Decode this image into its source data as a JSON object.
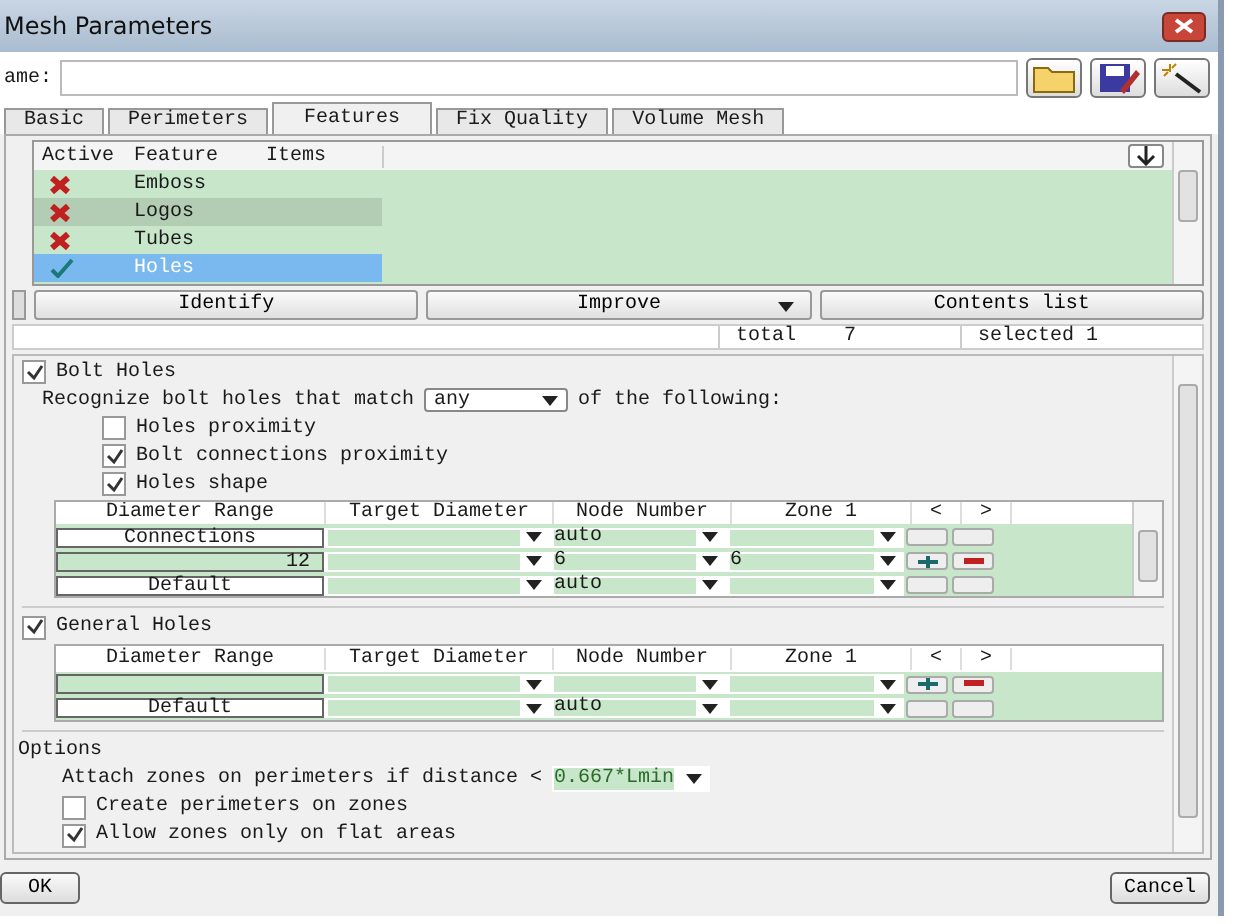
{
  "window": {
    "title": "Mesh Parameters"
  },
  "name_field": {
    "label": "ame:"
  },
  "tabs": [
    {
      "label": "Basic",
      "selected": false
    },
    {
      "label": "Perimeters",
      "selected": false
    },
    {
      "label": "Features",
      "selected": true
    },
    {
      "label": "Fix Quality",
      "selected": false
    },
    {
      "label": "Volume Mesh",
      "selected": false
    }
  ],
  "features": {
    "columns": [
      "Active",
      "Feature",
      "Items"
    ],
    "rows": [
      {
        "name": "Emboss",
        "active": false,
        "selected": false,
        "hovered": false
      },
      {
        "name": "Logos",
        "active": false,
        "selected": false,
        "hovered": true
      },
      {
        "name": "Tubes",
        "active": false,
        "selected": false,
        "hovered": false
      },
      {
        "name": "Holes",
        "active": true,
        "selected": true,
        "hovered": false
      }
    ]
  },
  "actions": [
    {
      "label": "Identify",
      "dropdown": false
    },
    {
      "label": "Improve",
      "dropdown": true
    },
    {
      "label": "Contents list",
      "dropdown": false
    }
  ],
  "status": {
    "total_label": "total",
    "total": "7",
    "selected_label": "selected 1"
  },
  "bolt_holes": {
    "label": "Bolt Holes",
    "checked": true,
    "match_text": "Recognize bolt holes that match",
    "match_value": "any",
    "match_suffix": "of the following:",
    "options": [
      {
        "label": "Holes proximity",
        "checked": false
      },
      {
        "label": "Bolt connections proximity",
        "checked": true
      },
      {
        "label": "Holes shape",
        "checked": true
      }
    ],
    "columns": [
      "Diameter Range",
      "Target Diameter",
      "Node Number",
      "Zone 1",
      "<",
      ">"
    ],
    "rows": [
      {
        "kind": "label",
        "range": "Connections",
        "node": "auto",
        "zone": "",
        "controls": false
      },
      {
        "kind": "value",
        "range": "12",
        "node": "6",
        "zone": "6",
        "controls": true
      },
      {
        "kind": "label",
        "range": "Default",
        "node": "auto",
        "zone": "",
        "controls": false
      }
    ]
  },
  "general_holes": {
    "label": "General Holes",
    "checked": true,
    "columns": [
      "Diameter Range",
      "Target Diameter",
      "Node Number",
      "Zone 1",
      "<",
      ">"
    ],
    "rows": [
      {
        "kind": "value",
        "range": "",
        "node": "",
        "zone": "",
        "controls": true
      },
      {
        "kind": "label",
        "range": "Default",
        "node": "auto",
        "zone": "",
        "controls": false
      }
    ]
  },
  "options": {
    "title": "Options",
    "attach_text": "Attach zones on perimeters if distance <",
    "attach_value": "0.667*Lmin",
    "checks": [
      {
        "label": "Create perimeters on zones",
        "checked": false
      },
      {
        "label": "Allow zones only on flat areas",
        "checked": true
      }
    ]
  },
  "buttons": [
    {
      "label": "OK"
    },
    {
      "label": "Cancel"
    }
  ]
}
